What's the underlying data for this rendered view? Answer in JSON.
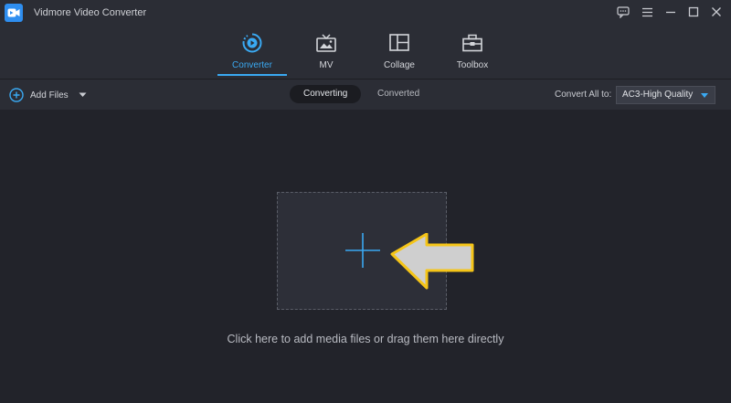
{
  "app": {
    "title": "Vidmore Video Converter"
  },
  "nav": {
    "tabs": [
      {
        "label": "Converter",
        "icon": "converter-icon",
        "active": true
      },
      {
        "label": "MV",
        "icon": "mv-icon",
        "active": false
      },
      {
        "label": "Collage",
        "icon": "collage-icon",
        "active": false
      },
      {
        "label": "Toolbox",
        "icon": "toolbox-icon",
        "active": false
      }
    ]
  },
  "toolbar": {
    "add_files": "Add Files",
    "segments": [
      "Converting",
      "Converted"
    ],
    "active_segment": "Converting",
    "convert_all_label": "Convert All to:",
    "format_value": "AC3-High Quality"
  },
  "main": {
    "hint": "Click here to add media files or drag them here directly"
  },
  "colors": {
    "accent": "#3aa9f2",
    "background": "#22232a",
    "panel": "#2b2d35",
    "annotation_arrow_fill": "#cfcfcf",
    "annotation_arrow_stroke": "#f5c518"
  }
}
